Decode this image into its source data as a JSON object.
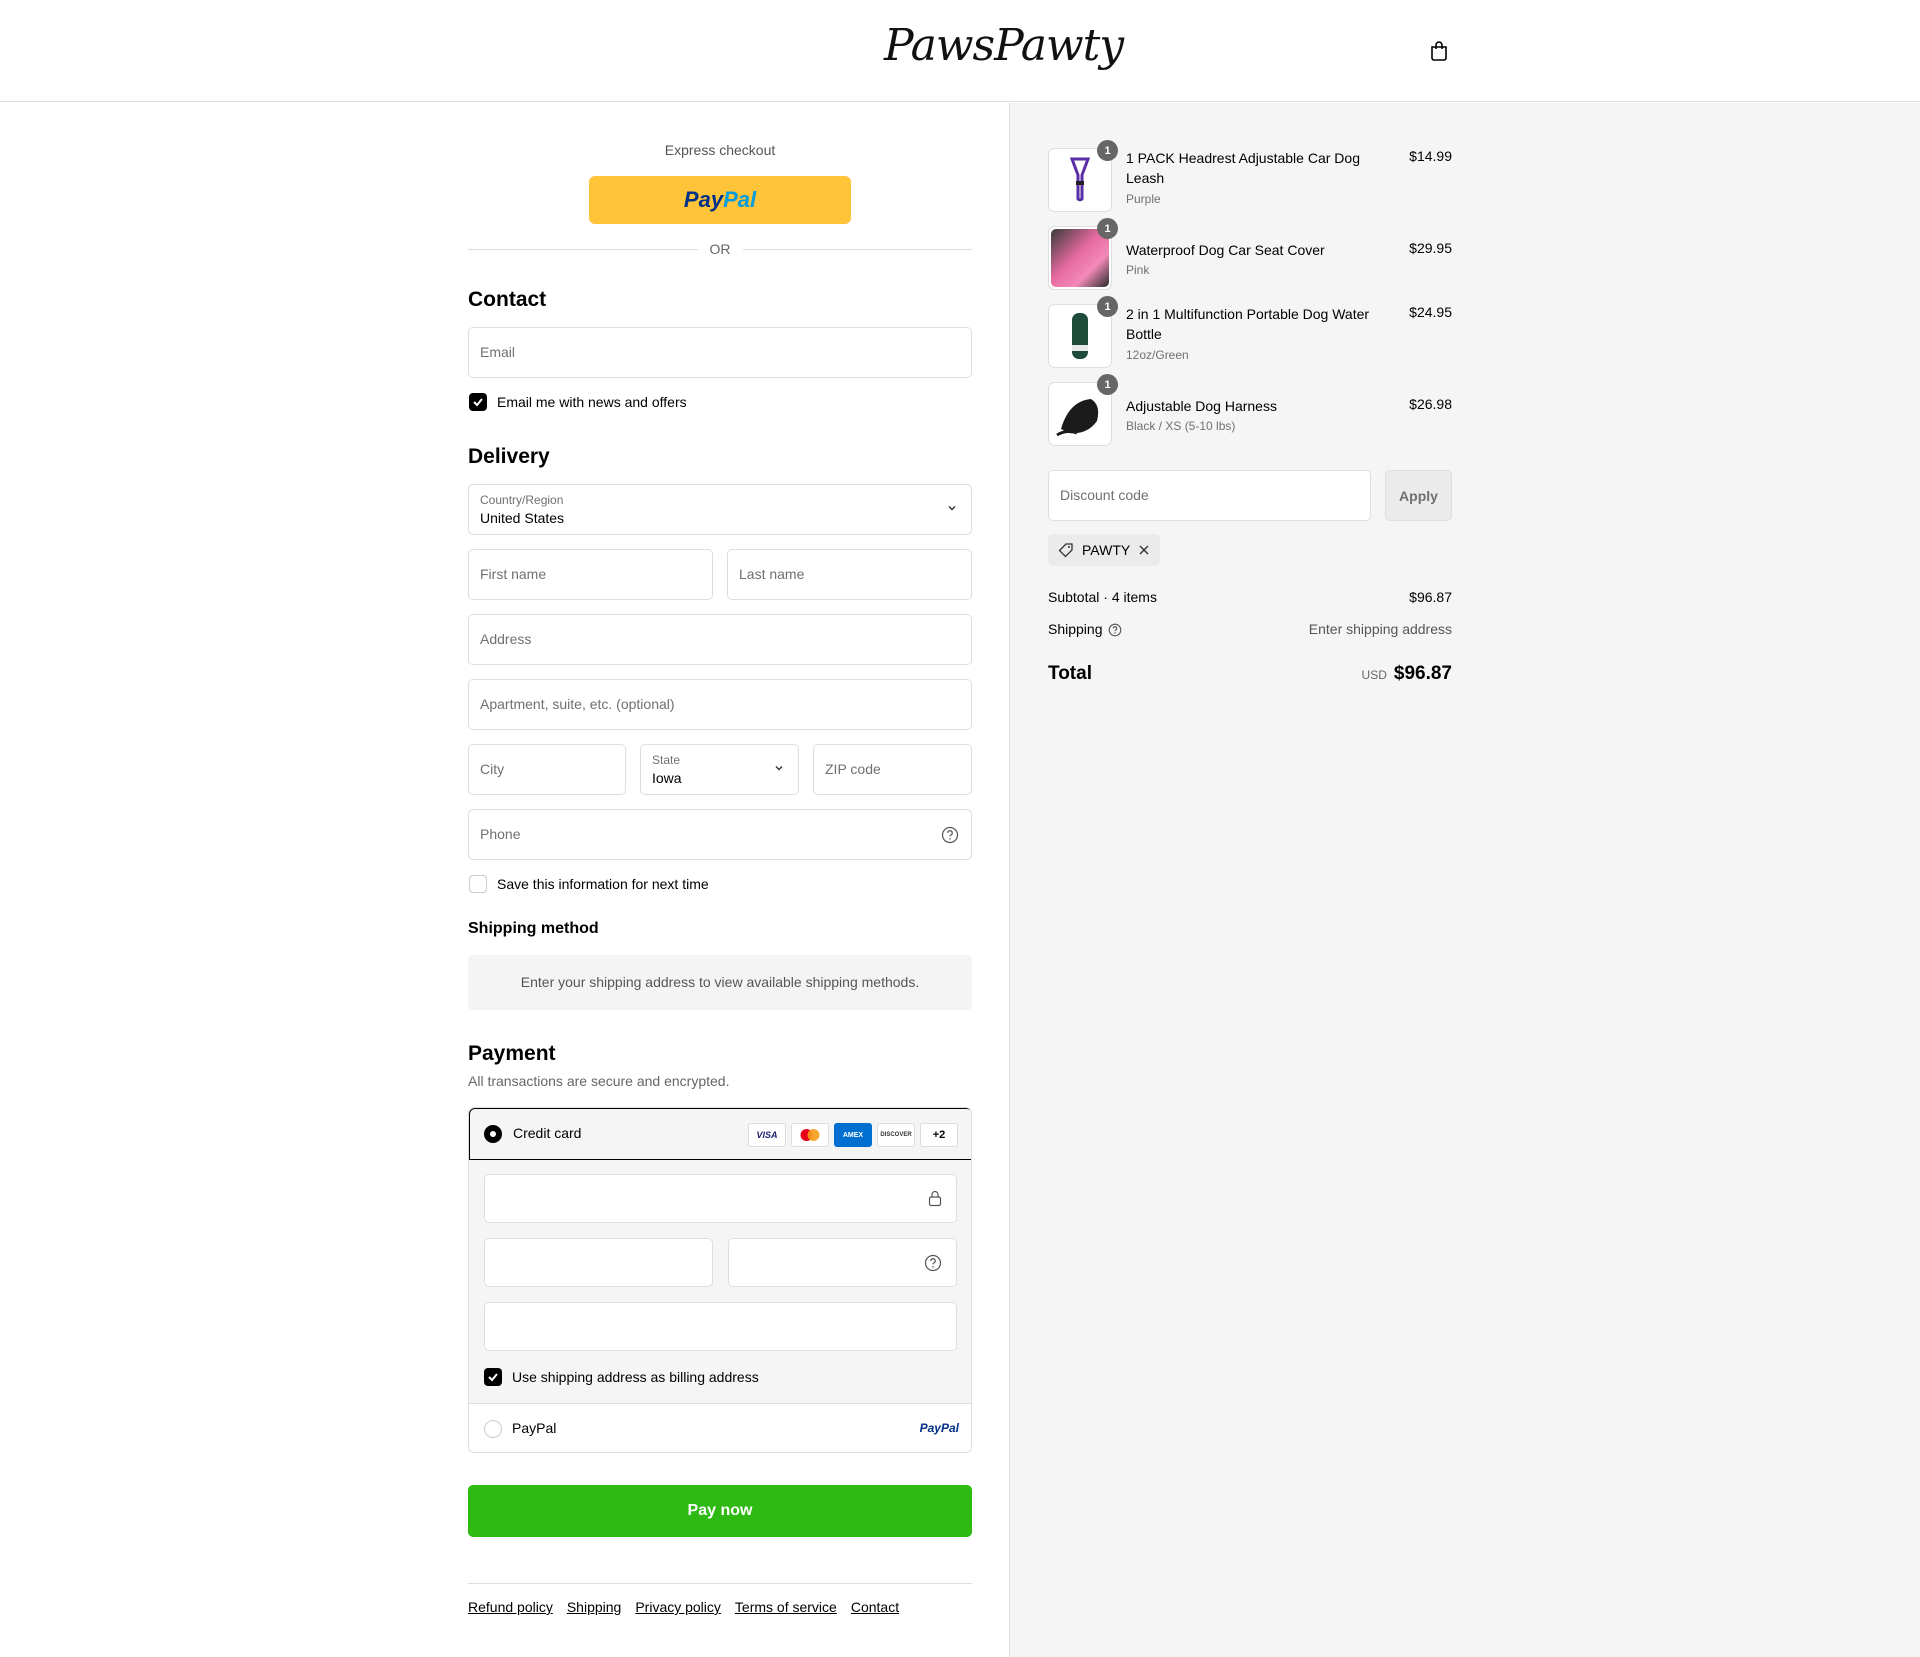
{
  "header": {
    "logo": "PawsPawty",
    "cart_icon": "bag-icon"
  },
  "express": {
    "label": "Express checkout",
    "paypal_part1": "Pay",
    "paypal_part2": "Pal",
    "or": "OR"
  },
  "contact": {
    "title": "Contact",
    "email_placeholder": "Email",
    "newsletter_label": "Email me with news and offers",
    "newsletter_checked": true
  },
  "delivery": {
    "title": "Delivery",
    "country_label": "Country/Region",
    "country_value": "United States",
    "first_name": "First name",
    "last_name": "Last name",
    "address": "Address",
    "apartment": "Apartment, suite, etc. (optional)",
    "city": "City",
    "state_label": "State",
    "state_value": "Iowa",
    "zip": "ZIP code",
    "phone": "Phone",
    "save_label": "Save this information for next time",
    "save_checked": false
  },
  "shipping_method": {
    "title": "Shipping method",
    "message": "Enter your shipping address to view available shipping methods."
  },
  "payment": {
    "title": "Payment",
    "subtitle": "All transactions are secure and encrypted.",
    "credit_card_label": "Credit card",
    "cards": [
      "VISA",
      "MC",
      "AMEX",
      "DISCOVER",
      "+2"
    ],
    "billing_label": "Use shipping address as billing address",
    "billing_checked": true,
    "paypal_label": "PayPal",
    "paypal_logo": "PayPal",
    "pay_now": "Pay now"
  },
  "footer": {
    "links": [
      "Refund policy",
      "Shipping",
      "Privacy policy",
      "Terms of service",
      "Contact"
    ]
  },
  "cart": {
    "items": [
      {
        "name": "1 PACK Headrest Adjustable Car Dog Leash",
        "variant": "Purple",
        "price": "$14.99",
        "qty": "1"
      },
      {
        "name": "Waterproof Dog Car Seat Cover",
        "variant": "Pink",
        "price": "$29.95",
        "qty": "1"
      },
      {
        "name": "2 in 1 Multifunction Portable Dog Water Bottle",
        "variant": "12oz/Green",
        "price": "$24.95",
        "qty": "1"
      },
      {
        "name": "Adjustable Dog Harness",
        "variant": "Black / XS (5-10 lbs)",
        "price": "$26.98",
        "qty": "1"
      }
    ],
    "discount_placeholder": "Discount code",
    "apply": "Apply",
    "applied_code": "PAWTY",
    "subtotal_label": "Subtotal · 4 items",
    "subtotal_value": "$96.87",
    "shipping_label": "Shipping",
    "shipping_value": "Enter shipping address",
    "total_label": "Total",
    "currency": "USD",
    "total_value": "$96.87"
  },
  "colors": {
    "accent_green": "#2fba13",
    "paypal_yellow": "#ffc439"
  }
}
